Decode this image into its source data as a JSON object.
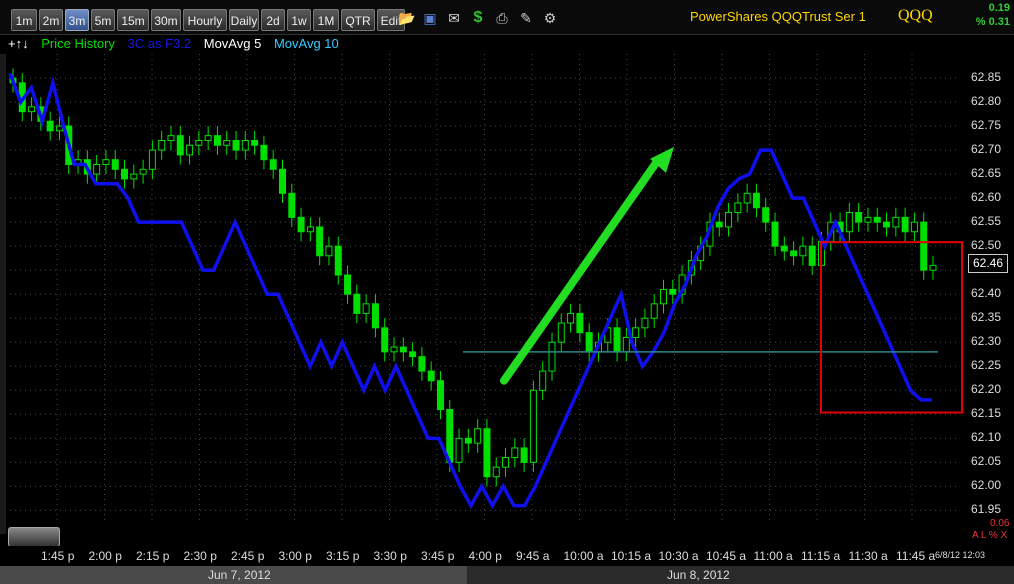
{
  "toolbar": {
    "timeframes": [
      "1m",
      "2m",
      "3m",
      "5m",
      "15m",
      "30m",
      "Hourly",
      "Daily",
      "2d",
      "1w",
      "1M",
      "QTR",
      "Edit"
    ],
    "active_timeframe": "3m",
    "icons": [
      "folder-icon",
      "save-icon",
      "mail-icon",
      "dollar-icon",
      "print-icon",
      "edit-icon",
      "gear-icon"
    ],
    "title": "PowerShares QQQTrust Ser 1",
    "symbol": "QQQ",
    "change": "0.19",
    "change_pct": "% 0.31"
  },
  "legend": {
    "price": "Price History",
    "threec": "3C as F3.2",
    "ma5": "MovAvg 5",
    "ma10": "MovAvg 10"
  },
  "last_price": "62.46",
  "timestamp": "6/8/12 12:03",
  "lower_value": "0.06",
  "lower_flags": "A L % X",
  "colors": {
    "up": "#00e000",
    "threec": "#1010ee",
    "annotation": "#e00000",
    "arrow": "#22dd22",
    "hline": "#2a8a8a"
  },
  "chart_data": {
    "type": "candlestick",
    "y_ticks": [
      "62.85",
      "62.80",
      "62.75",
      "62.70",
      "62.65",
      "62.60",
      "62.55",
      "62.50",
      "62.45",
      "62.40",
      "62.35",
      "62.30",
      "62.25",
      "62.20",
      "62.15",
      "62.10",
      "62.05",
      "62.00",
      "61.95"
    ],
    "ylim": [
      61.93,
      62.9
    ],
    "x_ticks": [
      "1:45 p",
      "2:00 p",
      "2:15 p",
      "2:30 p",
      "2:45 p",
      "3:00 p",
      "3:15 p",
      "3:30 p",
      "3:45 p",
      "4:00 p",
      "9:45 a",
      "10:00 a",
      "10:15 a",
      "10:30 a",
      "10:45 a",
      "11:00 a",
      "11:15 a",
      "11:30 a",
      "11:45 a"
    ],
    "dates": [
      "Jun 7, 2012",
      "Jun 8, 2012"
    ],
    "closes": [
      62.84,
      62.78,
      62.79,
      62.76,
      62.74,
      62.75,
      62.67,
      62.68,
      62.65,
      62.67,
      62.68,
      62.66,
      62.64,
      62.65,
      62.66,
      62.7,
      62.72,
      62.73,
      62.69,
      62.71,
      62.72,
      62.73,
      62.71,
      62.72,
      62.7,
      62.72,
      62.71,
      62.68,
      62.66,
      62.61,
      62.56,
      62.53,
      62.54,
      62.48,
      62.5,
      62.44,
      62.4,
      62.36,
      62.38,
      62.33,
      62.28,
      62.29,
      62.28,
      62.27,
      62.24,
      62.22,
      62.16,
      62.05,
      62.1,
      62.09,
      62.12,
      62.02,
      62.04,
      62.06,
      62.08,
      62.05,
      62.2,
      62.24,
      62.3,
      62.34,
      62.36,
      62.32,
      62.28,
      62.3,
      62.33,
      62.28,
      62.31,
      62.33,
      62.35,
      62.38,
      62.41,
      62.4,
      62.44,
      62.47,
      62.5,
      62.55,
      62.54,
      62.57,
      62.59,
      62.61,
      62.58,
      62.55,
      62.5,
      62.49,
      62.48,
      62.5,
      62.46,
      62.51,
      62.55,
      62.53,
      62.57,
      62.55,
      62.56,
      62.55,
      62.54,
      62.56,
      62.53,
      62.55,
      62.45,
      62.46
    ],
    "threec": [
      62.86,
      62.8,
      62.83,
      62.76,
      62.84,
      62.75,
      62.67,
      62.67,
      62.63,
      62.63,
      62.63,
      62.6,
      62.55,
      62.55,
      62.55,
      62.55,
      62.55,
      62.5,
      62.45,
      62.45,
      62.5,
      62.55,
      62.5,
      62.45,
      62.4,
      62.4,
      62.35,
      62.3,
      62.25,
      62.3,
      62.25,
      62.3,
      62.25,
      62.2,
      62.25,
      62.2,
      62.25,
      62.2,
      62.15,
      62.1,
      62.1,
      62.05,
      62.0,
      61.96,
      62.0,
      61.96,
      62.0,
      61.96,
      61.96,
      62.0,
      62.05,
      62.1,
      62.15,
      62.2,
      62.25,
      62.3,
      62.35,
      62.4,
      62.3,
      62.25,
      62.28,
      62.32,
      62.38,
      62.42,
      62.48,
      62.52,
      62.58,
      62.62,
      62.64,
      62.65,
      62.7,
      62.7,
      62.65,
      62.6,
      62.6,
      62.55,
      62.5,
      62.55,
      62.5,
      62.45,
      62.4,
      62.35,
      62.3,
      62.25,
      62.2,
      62.18,
      62.18
    ],
    "annotations": {
      "arrow_from": [
        62.22
      ],
      "arrow_to": [
        62.69
      ],
      "hline": 62.28,
      "box_y": [
        62.16,
        62.5
      ]
    }
  }
}
